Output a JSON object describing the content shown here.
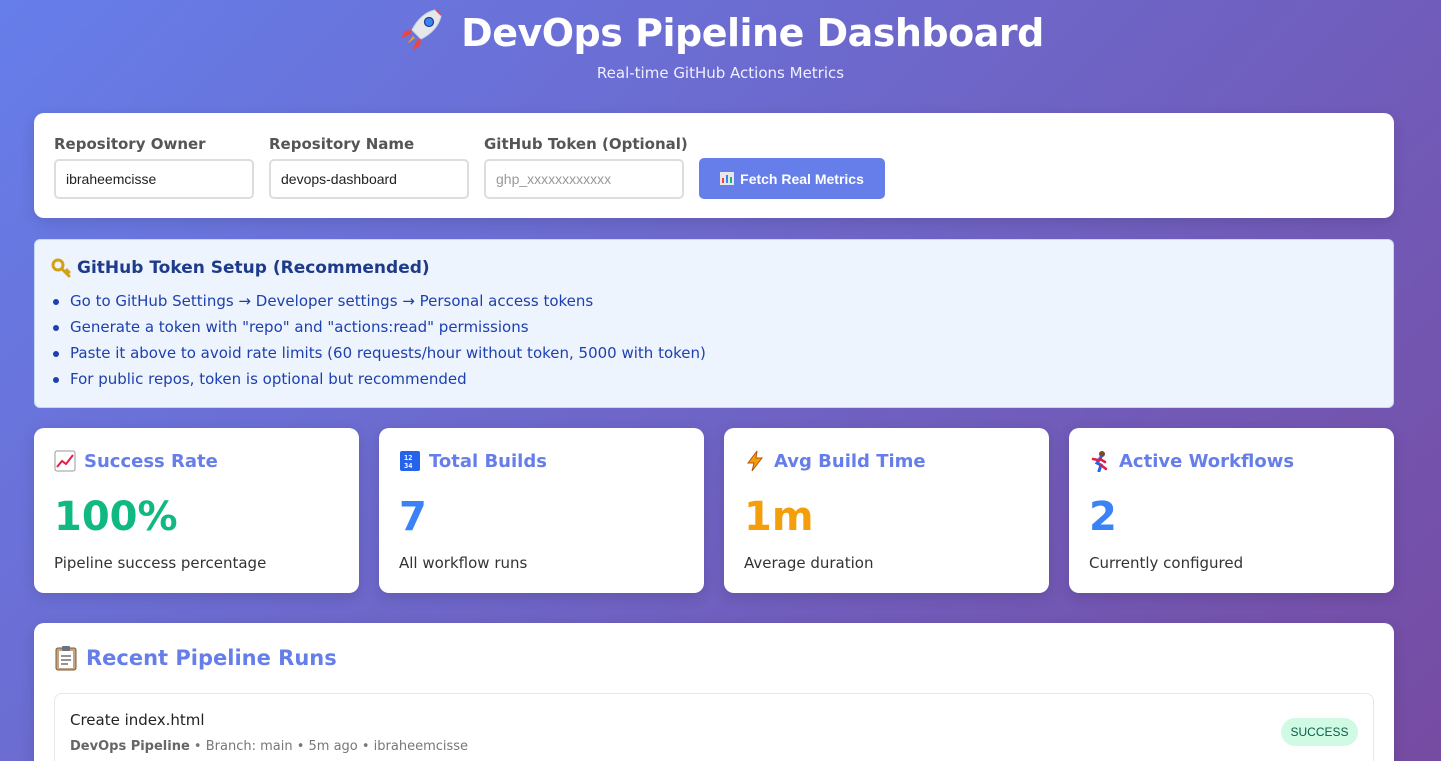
{
  "header": {
    "title": "DevOps Pipeline Dashboard",
    "subtitle": "Real-time GitHub Actions Metrics",
    "icon": "rocket-icon"
  },
  "form": {
    "owner_label": "Repository Owner",
    "owner_value": "ibraheemcisse",
    "name_label": "Repository Name",
    "name_value": "devops-dashboard",
    "token_label": "GitHub Token (Optional)",
    "token_placeholder": "ghp_xxxxxxxxxxxx",
    "fetch_label": "Fetch Real Metrics",
    "fetch_color": "#667eea"
  },
  "token_info": {
    "title": "GitHub Token Setup (Recommended)",
    "items": [
      "Go to GitHub Settings → Developer settings → Personal access tokens",
      "Generate a token with \"repo\" and \"actions:read\" permissions",
      "Paste it above to avoid rate limits (60 requests/hour without token, 5000 with token)",
      "For public repos, token is optional but recommended"
    ]
  },
  "metrics": [
    {
      "title": "Success Rate",
      "value": "100%",
      "desc": "Pipeline success percentage",
      "color": "#10b981",
      "icon": "chart-up-icon"
    },
    {
      "title": "Total Builds",
      "value": "7",
      "desc": "All workflow runs",
      "color": "#3b82f6",
      "icon": "numbers-icon"
    },
    {
      "title": "Avg Build Time",
      "value": "1m",
      "desc": "Average duration",
      "color": "#f59e0b",
      "icon": "lightning-icon"
    },
    {
      "title": "Active Workflows",
      "value": "2",
      "desc": "Currently configured",
      "color": "#3b82f6",
      "icon": "runner-icon"
    }
  ],
  "runs": {
    "title": "Recent Pipeline Runs",
    "items": [
      {
        "name": "Create index.html",
        "workflow": "DevOps Pipeline",
        "meta": " • Branch: main • 5m ago • ibraheemcisse",
        "status": "SUCCESS"
      }
    ]
  }
}
